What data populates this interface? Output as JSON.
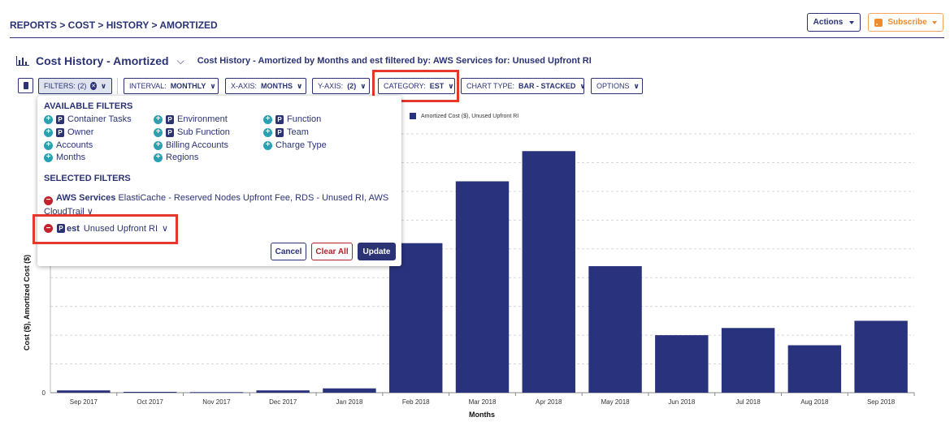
{
  "breadcrumb": "REPORTS > COST > HISTORY > AMORTIZED",
  "header_buttons": {
    "actions": "Actions",
    "subscribe": "Subscribe"
  },
  "title": "Cost History - Amortized",
  "subtitle": "Cost History - Amortized by Months and est filtered by: AWS Services for: Unused Upfront RI",
  "toolbar": {
    "filters_label": "FILTERS: (2)",
    "interval_label": "INTERVAL:",
    "interval_value": "MONTHLY",
    "xaxis_label": "X-AXIS:",
    "xaxis_value": "MONTHS",
    "yaxis_label": "Y-AXIS:",
    "yaxis_value": "(2)",
    "category_label": "CATEGORY:",
    "category_value": "EST",
    "charttype_label": "CHART TYPE:",
    "charttype_value": "BAR - STACKED",
    "options_label": "OPTIONS"
  },
  "filters_popup": {
    "available_heading": "AVAILABLE FILTERS",
    "available": [
      {
        "label": "Container Tasks",
        "p": true
      },
      {
        "label": "Owner",
        "p": true
      },
      {
        "label": "Accounts",
        "p": false
      },
      {
        "label": "Months",
        "p": false
      },
      {
        "label": "Environment",
        "p": true
      },
      {
        "label": "Sub Function",
        "p": true
      },
      {
        "label": "Billing Accounts",
        "p": false
      },
      {
        "label": "Regions",
        "p": false
      },
      {
        "label": "Function",
        "p": true
      },
      {
        "label": "Team",
        "p": true
      },
      {
        "label": "Charge Type",
        "p": false
      }
    ],
    "selected_heading": "SELECTED FILTERS",
    "selected_1_name": "AWS Services",
    "selected_1_values": "ElastiCache - Reserved Nodes Upfront Fee, RDS - Unused RI, AWS CloudTrail",
    "selected_2_name": "est",
    "selected_2_values": "Unused Upfront RI",
    "cancel": "Cancel",
    "clear_all": "Clear All",
    "update": "Update"
  },
  "colors": {
    "primary": "#2b3374",
    "bar": "#29327c",
    "highlight": "#e5372b",
    "subscribe": "#f08a2b",
    "plus": "#2aa1b3",
    "minus": "#c3222d"
  },
  "chart_data": {
    "type": "bar",
    "categories": [
      "Sep 2017",
      "Oct 2017",
      "Nov 2017",
      "Dec 2017",
      "Jan 2018",
      "Feb 2018",
      "Mar 2018",
      "Apr 2018",
      "May 2018",
      "Jun 2018",
      "Jul 2018",
      "Aug 2018",
      "Sep 2018"
    ],
    "series": [
      {
        "name": "Amortized Cost ($), Unused Upfront RI",
        "values": [
          0.08,
          0.03,
          0.02,
          0.08,
          0.15,
          5.2,
          7.35,
          8.4,
          4.4,
          2.0,
          2.25,
          1.65,
          2.5
        ]
      }
    ],
    "xlabel": "Months",
    "ylabel": "Cost ($), Amortized Cost ($)",
    "ylim": [
      0,
      9
    ],
    "grid": true,
    "legend_position": "top"
  }
}
